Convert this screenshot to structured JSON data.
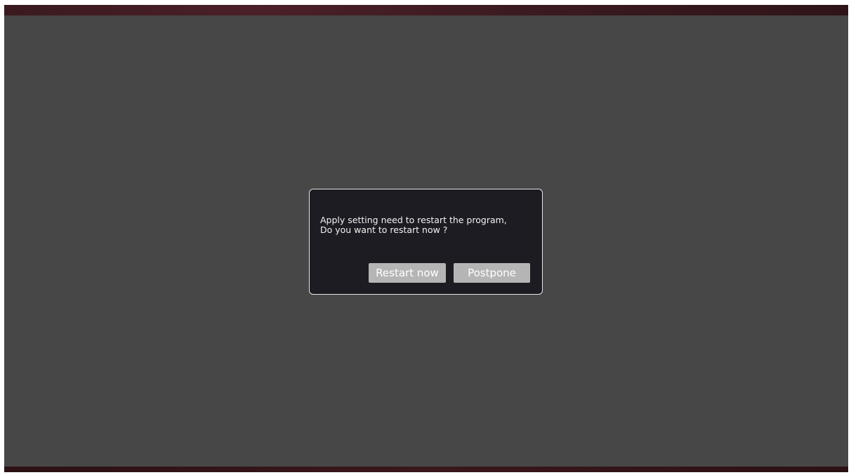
{
  "dialog": {
    "message_line1": "Apply setting need to restart the program,",
    "message_line2": "Do you want to restart now ?",
    "restart_label": "Restart now",
    "postpone_label": "Postpone"
  }
}
